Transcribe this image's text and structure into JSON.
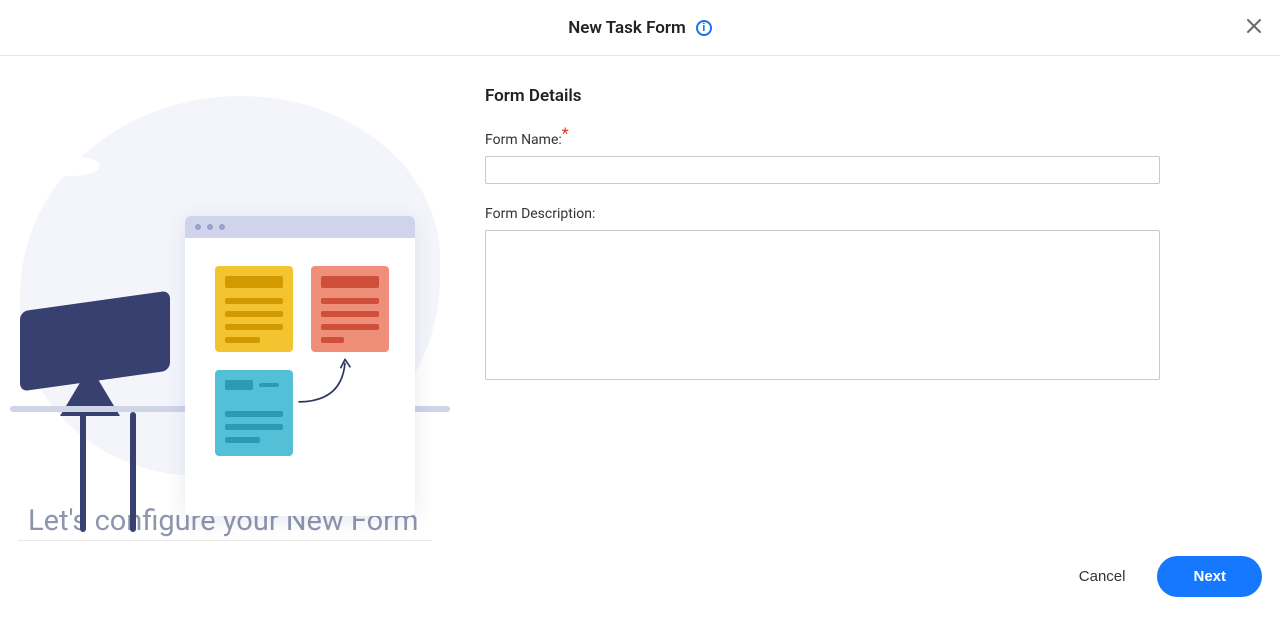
{
  "header": {
    "title": "New Task Form",
    "info_icon_label": "i"
  },
  "section": {
    "title": "Form Details"
  },
  "fields": {
    "name_label": "Form Name:",
    "name_value": "",
    "name_placeholder": "",
    "description_label": "Form Description:",
    "description_value": "",
    "description_placeholder": ""
  },
  "tagline": "Let's configure your New Form",
  "footer": {
    "cancel": "Cancel",
    "next": "Next"
  }
}
